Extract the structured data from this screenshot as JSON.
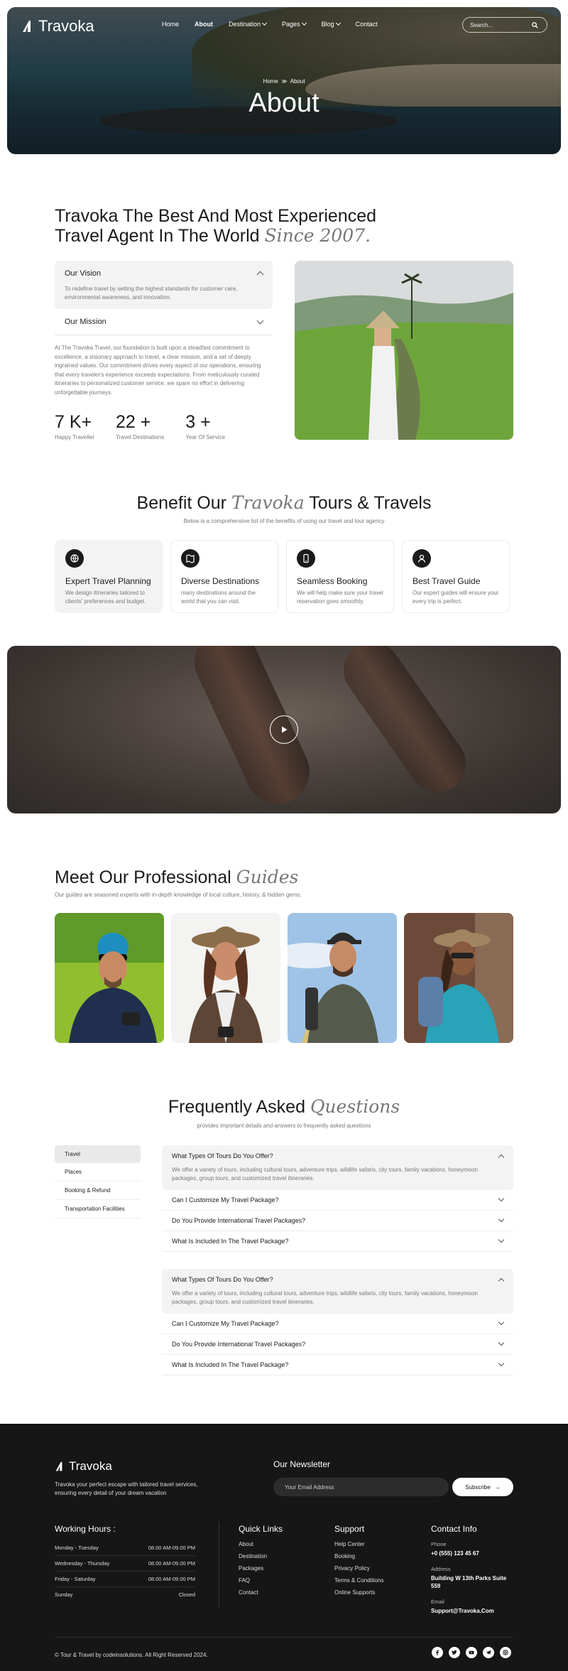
{
  "brand": {
    "name": "Travoka"
  },
  "nav": {
    "items": [
      {
        "label": "Home"
      },
      {
        "label": "About"
      },
      {
        "label": "Destination"
      },
      {
        "label": "Pages"
      },
      {
        "label": "Blog"
      },
      {
        "label": "Contact"
      }
    ],
    "search_placeholder": "Search..."
  },
  "hero": {
    "crumb_home": "Home",
    "crumb_current": "About",
    "title": "About"
  },
  "about": {
    "title_line1": "Travoka The Best And Most Experienced",
    "title_line2": "Travel Agent In The World",
    "title_accent": "Since 2007.",
    "vision_title": "Our Vision",
    "vision_text": "To redefine travel by setting the highest standards for customer care, environmental awareness, and innovation.",
    "mission_title": "Our Mission",
    "paragraph": "At The Travoka Travel, our foundation is built upon a steadfast commitment to excellence, a visionary approach to travel, a clear mission, and a set of deeply ingrained values. Our commitment drives every aspect of our operations, ensuring that every traveler's experience exceeds expectations. From meticulously curated itineraries to personalized customer service, we spare no effort in delivering unforgettable journeys.",
    "stats": [
      {
        "value": "7 K+",
        "label": "Happy Traveller"
      },
      {
        "value": "22 +",
        "label": "Travel Destinations"
      },
      {
        "value": "3 +",
        "label": "Year Of Service"
      }
    ]
  },
  "benefit": {
    "title_pre": "Benefit Our",
    "title_accent": "Travoka",
    "title_post": "Tours & Travels",
    "subtitle": "Below is a comprehensive list of the benefits of using our travel and tour agency",
    "cards": [
      {
        "title": "Expert Travel Planning",
        "text": "We design itineraries tailored to clients' preferences and budget.",
        "icon": "globe-icon"
      },
      {
        "title": "Diverse Destinations",
        "text": "many destinations around the world that you can visit.",
        "icon": "map-icon"
      },
      {
        "title": "Seamless Booking",
        "text": "We will help make sure your travel reservation goes smoothly.",
        "icon": "phone-icon"
      },
      {
        "title": "Best Travel Guide",
        "text": "Our expert guides will ensure your every trip is perfect.",
        "icon": "guide-icon"
      }
    ]
  },
  "guides": {
    "title_pre": "Meet Our Professional",
    "title_accent": "Guides",
    "subtitle": "Our guides are seasoned experts with in-depth knowledge of local culture, history, & hidden gems."
  },
  "faq": {
    "title_pre": "Frequently Asked",
    "title_accent": "Questions",
    "subtitle": "provides important details and answers to frequently asked questions",
    "tabs": [
      {
        "label": "Travel"
      },
      {
        "label": "Places"
      },
      {
        "label": "Booking & Refund"
      },
      {
        "label": "Transportation Facilities"
      }
    ],
    "groups": [
      {
        "open_q": "What Types Of Tours Do You Offer?",
        "open_a": "We offer a variety of tours, including cultural tours, adventure trips, wildlife safaris, city tours, family vacations, honeymoon packages, group tours, and customized travel itineraries.",
        "q2": "Can I Customize My Travel Package?",
        "q3": "Do You Provide International Travel Packages?",
        "q4": "What Is Included In The Travel Package?"
      },
      {
        "open_q": "What Types Of Tours Do You Offer?",
        "open_a": "We offer a variety of tours, including cultural tours, adventure trips, wildlife safaris, city tours, family vacations, honeymoon packages, group tours, and customized travel itineraries.",
        "q2": "Can I Customize My Travel Package?",
        "q3": "Do You Provide International Travel Packages?",
        "q4": "What Is Included In The Travel Package?"
      }
    ]
  },
  "footer": {
    "desc": "Travoka your perfect escape with tailored travel services, ensuring every detail of your dream vacation",
    "newsletter_title": "Our Newsletter",
    "newsletter_placeholder": "Your Email Address",
    "subscribe_label": "Subscribe",
    "hours_title": "Working Hours :",
    "hours": [
      {
        "day": "Monday - Tuesday",
        "time": "08.00 AM-09.00 PM"
      },
      {
        "day": "Wednesday - Thursday",
        "time": "08.00 AM-09.00 PM"
      },
      {
        "day": "Friday - Saturday",
        "time": "08.00 AM-09.00 PM"
      },
      {
        "day": "Sunday",
        "time": "Closed"
      }
    ],
    "quick_title": "Quick Links",
    "quick_links": [
      "About",
      "Destination",
      "Packages",
      "FAQ",
      "Contact"
    ],
    "support_title": "Support",
    "support_links": [
      "Help Center",
      "Booking",
      "Privacy Policy",
      "Terms & Conditions",
      "Online Supports"
    ],
    "contact_title": "Contact Info",
    "phone_label": "Phone",
    "phone": "+0 (555) 123 45 67",
    "address_label": "Address",
    "address": "Building W 13th Parks Suite 559",
    "email_label": "Email",
    "email": "Support@Travoka.Com",
    "copyright": "© Tour & Travel by codeinsolutions. All Right Reserved 2024."
  },
  "colors": {
    "dark": "#161616",
    "text": "#1b1b1b",
    "muted": "#777777",
    "card": "#f3f3f3"
  }
}
